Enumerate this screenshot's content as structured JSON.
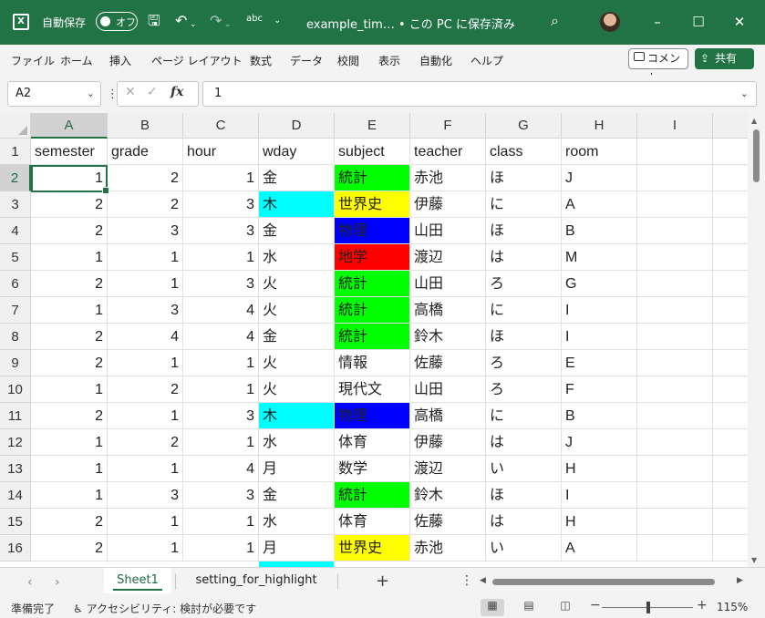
{
  "titlebar": {
    "autosave_label": "自動保存",
    "toggle_state": "オフ",
    "doc_title": "example_tim… • この PC に保存済み",
    "abc": "abc"
  },
  "menu": [
    "ファイル",
    "ホーム",
    "挿入",
    "ページ レイアウト",
    "数式",
    "データ",
    "校閲",
    "表示",
    "自動化",
    "ヘルプ"
  ],
  "comment_label": "コメント",
  "share_label": "共有",
  "namebox": "A2",
  "formula_value": "1",
  "columns": [
    "A",
    "B",
    "C",
    "D",
    "E",
    "F",
    "G",
    "H",
    "I"
  ],
  "rows": [
    "1",
    "2",
    "3",
    "4",
    "5",
    "6",
    "7",
    "8",
    "9",
    "10",
    "11",
    "12",
    "13",
    "14",
    "15",
    "16"
  ],
  "table": {
    "headers": [
      "semester",
      "grade",
      "hour",
      "wday",
      "subject",
      "teacher",
      "class",
      "room"
    ],
    "data": [
      [
        "1",
        "2",
        "1",
        "金",
        "統計",
        "赤池",
        "ほ",
        "J"
      ],
      [
        "2",
        "2",
        "3",
        "木",
        "世界史",
        "伊藤",
        "に",
        "A"
      ],
      [
        "2",
        "3",
        "3",
        "金",
        "物理",
        "山田",
        "ほ",
        "B"
      ],
      [
        "1",
        "1",
        "1",
        "水",
        "地学",
        "渡辺",
        "は",
        "M"
      ],
      [
        "2",
        "1",
        "3",
        "火",
        "統計",
        "山田",
        "ろ",
        "G"
      ],
      [
        "1",
        "3",
        "4",
        "火",
        "統計",
        "高橋",
        "に",
        "I"
      ],
      [
        "2",
        "4",
        "4",
        "金",
        "統計",
        "鈴木",
        "ほ",
        "I"
      ],
      [
        "2",
        "1",
        "1",
        "火",
        "情報",
        "佐藤",
        "ろ",
        "E"
      ],
      [
        "1",
        "2",
        "1",
        "火",
        "現代文",
        "山田",
        "ろ",
        "F"
      ],
      [
        "2",
        "1",
        "3",
        "木",
        "物理",
        "高橋",
        "に",
        "B"
      ],
      [
        "1",
        "2",
        "1",
        "水",
        "体育",
        "伊藤",
        "は",
        "J"
      ],
      [
        "1",
        "1",
        "4",
        "月",
        "数学",
        "渡辺",
        "い",
        "H"
      ],
      [
        "1",
        "3",
        "3",
        "金",
        "統計",
        "鈴木",
        "ほ",
        "I"
      ],
      [
        "2",
        "1",
        "1",
        "水",
        "体育",
        "佐藤",
        "は",
        "H"
      ],
      [
        "2",
        "1",
        "1",
        "月",
        "世界史",
        "赤池",
        "い",
        "A"
      ]
    ],
    "wday_highlight": {
      "木": "#00ffff"
    },
    "subject_highlight": {
      "統計": "#00ff00",
      "世界史": "#ffff00",
      "物理": "#0000ff",
      "地学": "#ff0000"
    }
  },
  "sheets": [
    "Sheet1",
    "setting_for_highlight"
  ],
  "status": {
    "ready": "準備完了",
    "accessibility": "アクセシビリティ: 検討が必要です",
    "zoom": "115%"
  },
  "colors": {
    "accent": "#217346"
  }
}
